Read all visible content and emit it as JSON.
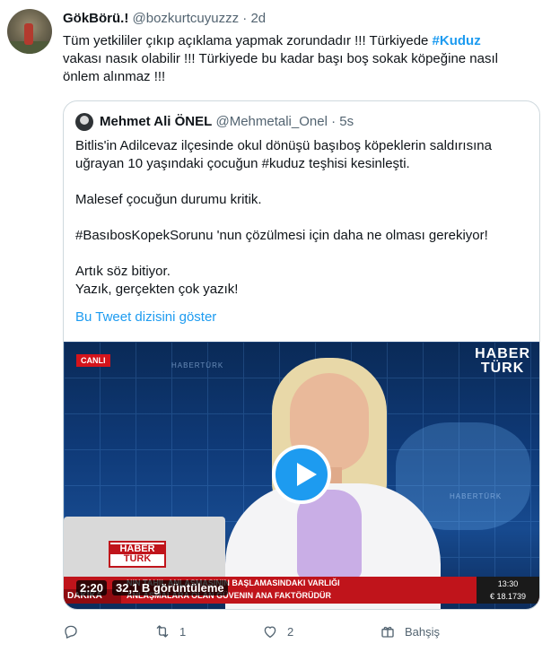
{
  "tweet": {
    "author_name": "GökBörü.!",
    "author_handle": "@bozkurtcuyuzzz",
    "separator": "·",
    "time": "2d",
    "text_part1": "Tüm yetkililer çıkıp açıklama yapmak zorundadır !!! Türkiyede ",
    "hashtag": "#Kuduz",
    "text_part2": " vakası nasık olabilir !!! Türkiyede bu kadar başı boş sokak köpeğine nasıl önlem alınmaz !!!"
  },
  "quote": {
    "author_name": "Mehmet Ali ÖNEL",
    "author_handle": "@Mehmetali_Onel",
    "separator": "·",
    "time": "5s",
    "paragraphs": [
      "Bitlis'in Adilcevaz ilçesinde okul dönüşü  başıboş köpeklerin saldırısına uğrayan 10 yaşındaki çocuğun #kuduz teşhisi kesinleşti.",
      "",
      "Malesef çocuğun durumu kritik.",
      "",
      " #BasıbosKopekSorunu 'nun çözülmesi için daha ne olması gerekiyor!",
      "",
      "Artık söz bitiyor.",
      "Yazık, gerçekten çok yazık!"
    ],
    "show_thread": "Bu Tweet dizisini göster"
  },
  "video": {
    "live_badge": "CANLI",
    "channel_logo_line1": "HABER",
    "channel_logo_line2": "TÜRK",
    "bg_label1": "HABERTÜRK",
    "bg_label2": "HABERTÜRK",
    "desk_logo_line1": "HABER",
    "desk_logo_line2": "TÜRK",
    "duration": "2:20",
    "views": "32,1 B görüntüleme",
    "ticker_line1": "NIN TAHIL ANLAŞMASININ BAŞLAMASINDAKI VARLIĞI",
    "ticker_line2": "ANLAŞMALARA OLAN GÜVENIN ANA FAKTÖRÜDÜR",
    "ticker_tag": "DAKİKA",
    "clock_time": "13:30",
    "clock_value": "€ 18.1739"
  },
  "actions": {
    "reply_count": "",
    "retweet_count": "1",
    "like_count": "2",
    "tip_label": "Bahşiş"
  }
}
